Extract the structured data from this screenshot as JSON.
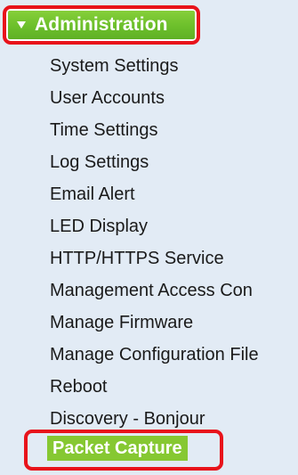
{
  "nav": {
    "header": {
      "title": "Administration",
      "icon": "triangle-down-icon"
    },
    "items": [
      {
        "label": "System Settings"
      },
      {
        "label": "User Accounts"
      },
      {
        "label": "Time Settings"
      },
      {
        "label": "Log Settings"
      },
      {
        "label": "Email Alert"
      },
      {
        "label": "LED Display"
      },
      {
        "label": "HTTP/HTTPS Service"
      },
      {
        "label": "Management Access Con"
      },
      {
        "label": "Manage Firmware"
      },
      {
        "label": "Manage Configuration File"
      },
      {
        "label": "Reboot"
      },
      {
        "label": "Discovery - Bonjour"
      }
    ],
    "selected": {
      "label": "Packet Capture"
    }
  },
  "colors": {
    "panel_background": "#e2ebf5",
    "header_green": "#6cbf2b",
    "selected_green": "#86c832",
    "highlight_red": "#e8131b",
    "item_text": "#1a1a1a"
  }
}
